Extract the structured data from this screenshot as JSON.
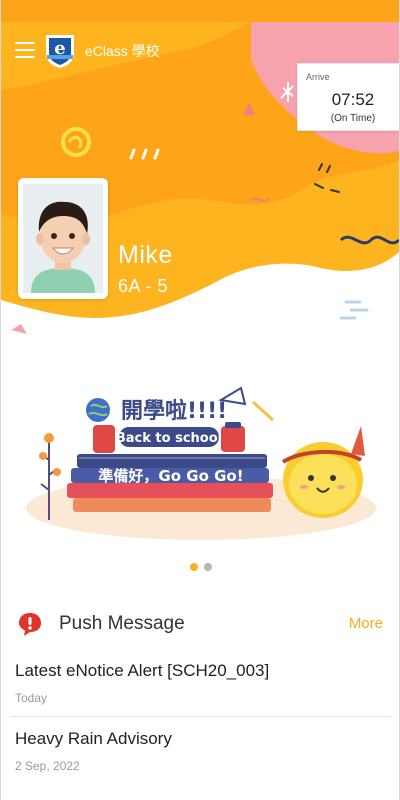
{
  "app": {
    "school_name": "eClass 學校",
    "logo_letter": "e"
  },
  "attendance": {
    "label": "Arrive",
    "time": "07:52",
    "status": "(On Time)"
  },
  "student": {
    "name": "Mike",
    "class": "6A - 5"
  },
  "banner": {
    "headline": "開學啦!!!!",
    "subheadline": "Back to school",
    "tagline": "準備好，Go Go Go!",
    "active_index": 0,
    "total": 2
  },
  "push": {
    "title": "Push Message",
    "more_label": "More",
    "items": [
      {
        "title": "Latest eNotice Alert [SCH20_003]",
        "date": "Today"
      },
      {
        "title": "Heavy Rain Advisory",
        "date": "2 Sep, 2022"
      }
    ]
  },
  "colors": {
    "accent": "#f5b21b",
    "orange": "#fda419",
    "pink": "#f6a3ae",
    "sky": "#cfe4ef",
    "dot_inactive": "#b5b5b5",
    "alert": "#e0352b"
  },
  "icons": {
    "menu": "hamburger-icon",
    "push": "alert-bubble-icon",
    "logo": "eclass-shield-logo"
  }
}
